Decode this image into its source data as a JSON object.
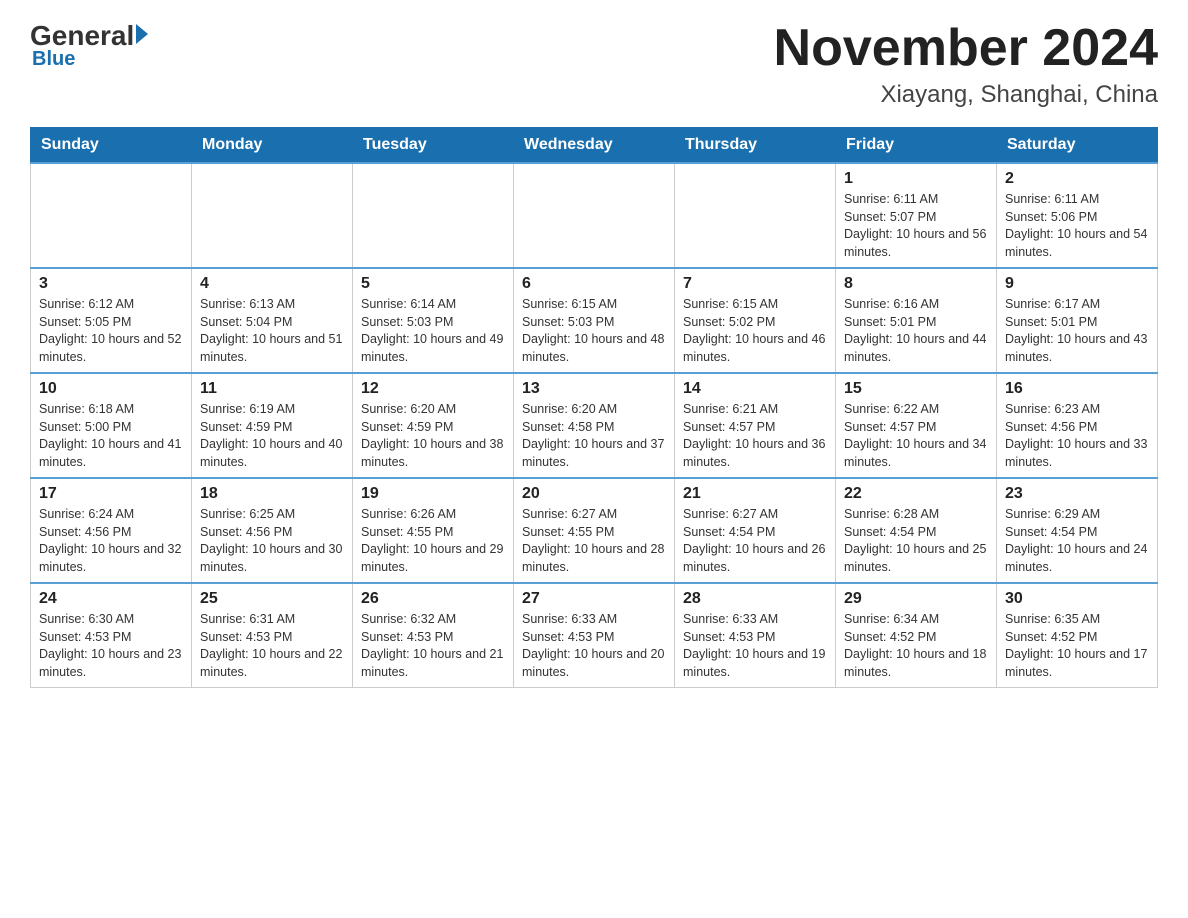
{
  "header": {
    "logo_general": "General",
    "logo_blue": "Blue",
    "month_title": "November 2024",
    "location": "Xiayang, Shanghai, China"
  },
  "days_of_week": [
    "Sunday",
    "Monday",
    "Tuesday",
    "Wednesday",
    "Thursday",
    "Friday",
    "Saturday"
  ],
  "weeks": [
    {
      "days": [
        {
          "number": "",
          "info": ""
        },
        {
          "number": "",
          "info": ""
        },
        {
          "number": "",
          "info": ""
        },
        {
          "number": "",
          "info": ""
        },
        {
          "number": "",
          "info": ""
        },
        {
          "number": "1",
          "info": "Sunrise: 6:11 AM\nSunset: 5:07 PM\nDaylight: 10 hours and 56 minutes."
        },
        {
          "number": "2",
          "info": "Sunrise: 6:11 AM\nSunset: 5:06 PM\nDaylight: 10 hours and 54 minutes."
        }
      ]
    },
    {
      "days": [
        {
          "number": "3",
          "info": "Sunrise: 6:12 AM\nSunset: 5:05 PM\nDaylight: 10 hours and 52 minutes."
        },
        {
          "number": "4",
          "info": "Sunrise: 6:13 AM\nSunset: 5:04 PM\nDaylight: 10 hours and 51 minutes."
        },
        {
          "number": "5",
          "info": "Sunrise: 6:14 AM\nSunset: 5:03 PM\nDaylight: 10 hours and 49 minutes."
        },
        {
          "number": "6",
          "info": "Sunrise: 6:15 AM\nSunset: 5:03 PM\nDaylight: 10 hours and 48 minutes."
        },
        {
          "number": "7",
          "info": "Sunrise: 6:15 AM\nSunset: 5:02 PM\nDaylight: 10 hours and 46 minutes."
        },
        {
          "number": "8",
          "info": "Sunrise: 6:16 AM\nSunset: 5:01 PM\nDaylight: 10 hours and 44 minutes."
        },
        {
          "number": "9",
          "info": "Sunrise: 6:17 AM\nSunset: 5:01 PM\nDaylight: 10 hours and 43 minutes."
        }
      ]
    },
    {
      "days": [
        {
          "number": "10",
          "info": "Sunrise: 6:18 AM\nSunset: 5:00 PM\nDaylight: 10 hours and 41 minutes."
        },
        {
          "number": "11",
          "info": "Sunrise: 6:19 AM\nSunset: 4:59 PM\nDaylight: 10 hours and 40 minutes."
        },
        {
          "number": "12",
          "info": "Sunrise: 6:20 AM\nSunset: 4:59 PM\nDaylight: 10 hours and 38 minutes."
        },
        {
          "number": "13",
          "info": "Sunrise: 6:20 AM\nSunset: 4:58 PM\nDaylight: 10 hours and 37 minutes."
        },
        {
          "number": "14",
          "info": "Sunrise: 6:21 AM\nSunset: 4:57 PM\nDaylight: 10 hours and 36 minutes."
        },
        {
          "number": "15",
          "info": "Sunrise: 6:22 AM\nSunset: 4:57 PM\nDaylight: 10 hours and 34 minutes."
        },
        {
          "number": "16",
          "info": "Sunrise: 6:23 AM\nSunset: 4:56 PM\nDaylight: 10 hours and 33 minutes."
        }
      ]
    },
    {
      "days": [
        {
          "number": "17",
          "info": "Sunrise: 6:24 AM\nSunset: 4:56 PM\nDaylight: 10 hours and 32 minutes."
        },
        {
          "number": "18",
          "info": "Sunrise: 6:25 AM\nSunset: 4:56 PM\nDaylight: 10 hours and 30 minutes."
        },
        {
          "number": "19",
          "info": "Sunrise: 6:26 AM\nSunset: 4:55 PM\nDaylight: 10 hours and 29 minutes."
        },
        {
          "number": "20",
          "info": "Sunrise: 6:27 AM\nSunset: 4:55 PM\nDaylight: 10 hours and 28 minutes."
        },
        {
          "number": "21",
          "info": "Sunrise: 6:27 AM\nSunset: 4:54 PM\nDaylight: 10 hours and 26 minutes."
        },
        {
          "number": "22",
          "info": "Sunrise: 6:28 AM\nSunset: 4:54 PM\nDaylight: 10 hours and 25 minutes."
        },
        {
          "number": "23",
          "info": "Sunrise: 6:29 AM\nSunset: 4:54 PM\nDaylight: 10 hours and 24 minutes."
        }
      ]
    },
    {
      "days": [
        {
          "number": "24",
          "info": "Sunrise: 6:30 AM\nSunset: 4:53 PM\nDaylight: 10 hours and 23 minutes."
        },
        {
          "number": "25",
          "info": "Sunrise: 6:31 AM\nSunset: 4:53 PM\nDaylight: 10 hours and 22 minutes."
        },
        {
          "number": "26",
          "info": "Sunrise: 6:32 AM\nSunset: 4:53 PM\nDaylight: 10 hours and 21 minutes."
        },
        {
          "number": "27",
          "info": "Sunrise: 6:33 AM\nSunset: 4:53 PM\nDaylight: 10 hours and 20 minutes."
        },
        {
          "number": "28",
          "info": "Sunrise: 6:33 AM\nSunset: 4:53 PM\nDaylight: 10 hours and 19 minutes."
        },
        {
          "number": "29",
          "info": "Sunrise: 6:34 AM\nSunset: 4:52 PM\nDaylight: 10 hours and 18 minutes."
        },
        {
          "number": "30",
          "info": "Sunrise: 6:35 AM\nSunset: 4:52 PM\nDaylight: 10 hours and 17 minutes."
        }
      ]
    }
  ]
}
